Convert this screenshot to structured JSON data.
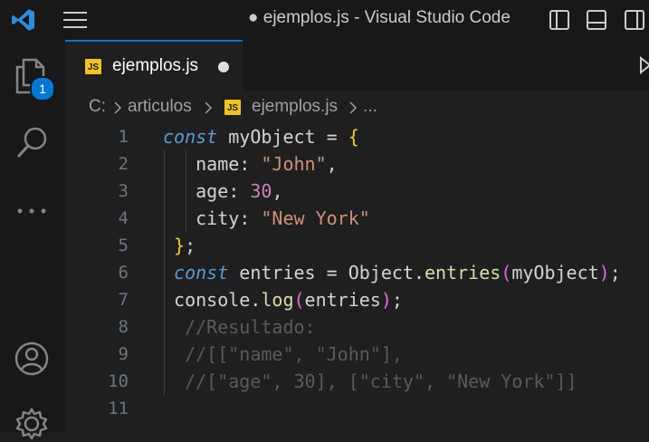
{
  "window": {
    "title": "● ejemplos.js - Visual Studio Code"
  },
  "activity_bar": {
    "explorer_badge": "1",
    "items": [
      "explorer",
      "search",
      "more",
      "accounts",
      "manage"
    ]
  },
  "tab": {
    "label": "ejemplos.js",
    "icon_text": "JS",
    "dirty": true
  },
  "breadcrumb": {
    "parts": [
      "C:",
      "articulos",
      "ejemplos.js",
      "..."
    ],
    "icon_text": "JS"
  },
  "editor": {
    "line_numbers": [
      "1",
      "2",
      "3",
      "4",
      "5",
      "6",
      "7",
      "8",
      "9",
      "10",
      "11"
    ],
    "lines": [
      [
        {
          "t": "kw",
          "v": "const"
        },
        {
          "t": "id",
          "v": " myObject "
        },
        {
          "t": "op",
          "v": "="
        },
        {
          "t": "id",
          "v": " "
        },
        {
          "t": "brace",
          "v": "{"
        }
      ],
      [
        {
          "t": "prop",
          "v": "   name"
        },
        {
          "t": "op",
          "v": ": "
        },
        {
          "t": "str",
          "v": "\"John\""
        },
        {
          "t": "op",
          "v": ","
        }
      ],
      [
        {
          "t": "prop",
          "v": "   age"
        },
        {
          "t": "op",
          "v": ": "
        },
        {
          "t": "num",
          "v": "30"
        },
        {
          "t": "op",
          "v": ","
        }
      ],
      [
        {
          "t": "prop",
          "v": "   city"
        },
        {
          "t": "op",
          "v": ": "
        },
        {
          "t": "str",
          "v": "\"New York\""
        }
      ],
      [
        {
          "t": "brace",
          "v": " }"
        },
        {
          "t": "op",
          "v": ";"
        }
      ],
      [
        {
          "t": "kw",
          "v": " const"
        },
        {
          "t": "id",
          "v": " entries "
        },
        {
          "t": "op",
          "v": "="
        },
        {
          "t": "id",
          "v": " Object."
        },
        {
          "t": "fn",
          "v": "entries"
        },
        {
          "t": "paren",
          "v": "("
        },
        {
          "t": "id",
          "v": "myObject"
        },
        {
          "t": "paren",
          "v": ")"
        },
        {
          "t": "op",
          "v": ";"
        }
      ],
      [
        {
          "t": "id",
          "v": " console."
        },
        {
          "t": "fn",
          "v": "log"
        },
        {
          "t": "paren",
          "v": "("
        },
        {
          "t": "id",
          "v": "entries"
        },
        {
          "t": "paren",
          "v": ")"
        },
        {
          "t": "op",
          "v": ";"
        }
      ],
      [
        {
          "t": "cm",
          "v": "  //Resultado:"
        }
      ],
      [
        {
          "t": "cm",
          "v": "  //[[\"name\", \"John\"],"
        }
      ],
      [
        {
          "t": "cm",
          "v": "  //[\"age\", 30], [\"city\", \"New York\"]]"
        }
      ],
      []
    ]
  },
  "colors": {
    "accent": "#0078d4",
    "badge": "#0078d4",
    "js_icon": "#f0c419"
  }
}
